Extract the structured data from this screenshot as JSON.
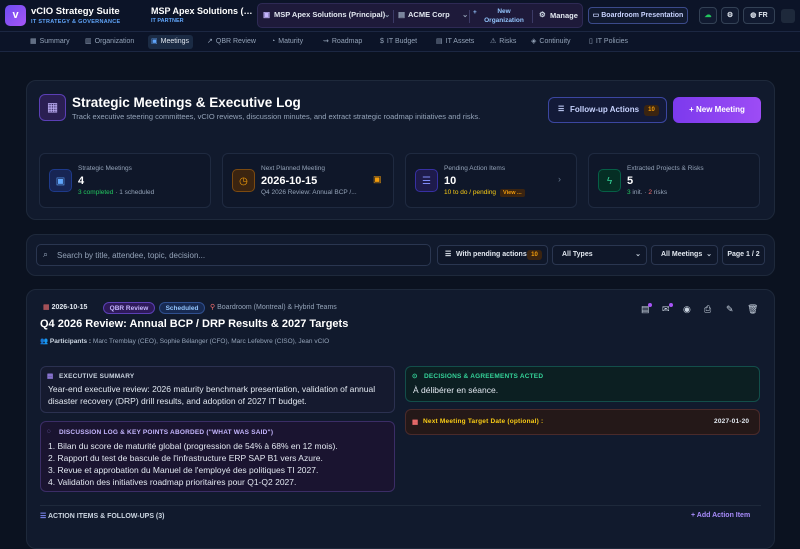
{
  "app": {
    "logo": "v",
    "title": "vCIO Strategy Suite",
    "subtitle": "IT STRATEGY & GOVERNANCE"
  },
  "tenant": {
    "title": "MSP Apex Solutions (Principal)",
    "subtitle": "IT PARTNER"
  },
  "context": {
    "msp": "MSP Apex Solutions (Principal)",
    "client": "ACME Corp",
    "new_org": "New Organization",
    "manage": "Manage"
  },
  "header_actions": {
    "presentation": "Boardroom Presentation",
    "language": "FR"
  },
  "nav": [
    {
      "label": "Summary",
      "icon": "summary-icon"
    },
    {
      "label": "Organization",
      "icon": "organization-icon"
    },
    {
      "label": "Meetings",
      "icon": "calendar-icon"
    },
    {
      "label": "QBR Review",
      "icon": "trend-icon"
    },
    {
      "label": "Maturity",
      "icon": "gauge-icon"
    },
    {
      "label": "Roadmap",
      "icon": "road-icon"
    },
    {
      "label": "IT Budget",
      "icon": "dollar-icon"
    },
    {
      "label": "IT Assets",
      "icon": "assets-icon"
    },
    {
      "label": "Risks",
      "icon": "warning-icon"
    },
    {
      "label": "Continuity",
      "icon": "shield-icon"
    },
    {
      "label": "IT Policies",
      "icon": "document-icon"
    }
  ],
  "page": {
    "title": "Strategic Meetings & Executive Log",
    "subtitle": "Track executive steering committees, vCIO reviews, discussion minutes, and extract strategic roadmap initiatives and risks.",
    "followup_label": "Follow-up Actions",
    "followup_count": "10",
    "new_meeting_label": "+ New Meeting"
  },
  "stats": [
    {
      "label": "Strategic Meetings",
      "value": "4",
      "sub_a": "3 completed",
      "sub_b": " · 1 scheduled"
    },
    {
      "label": "Next Planned Meeting",
      "value": "2026-10-15",
      "sub_a": "",
      "sub_b": "Q4 2026 Review: Annual BCP /..."
    },
    {
      "label": "Pending Action Items",
      "value": "10",
      "sub_a": "10 to do / pending",
      "sub_b": "View ..."
    },
    {
      "label": "Extracted Projects & Risks",
      "value": "5",
      "sub_a": "3",
      "sub_b": " init. · ",
      "sub_c": "2",
      "sub_d": " risks"
    }
  ],
  "filters": {
    "search_placeholder": "Search by title, attendee, topic, decision...",
    "pending_label": "With pending actions",
    "pending_count": "10",
    "type_select": "All Types",
    "meetings_select": "All Meetings",
    "page": "Page 1 / 2"
  },
  "meeting": {
    "date": "2026-10-15",
    "type": "QBR Review",
    "status": "Scheduled",
    "location": "Boardroom (Montreal) & Hybrid Teams",
    "title": "Q4 2026 Review: Annual BCP / DRP Results & 2027 Targets",
    "participants_label": "Participants :",
    "participants": "Marc Tremblay (CEO), Sophie Bélanger (CFO), Marc Lefebvre (CISO), Jean vCIO",
    "summary_heading": "EXECUTIVE SUMMARY",
    "summary_text": "Year-end executive review: 2026 maturity benchmark presentation, validation of annual disaster recovery (DRP) drill results, and adoption of 2027 IT budget.",
    "decisions_heading": "DECISIONS & AGREEMENTS ACTED",
    "decisions_text": "À délibérer en séance.",
    "discussion_heading": "DISCUSSION LOG & KEY POINTS ABORDED (\"WHAT WAS SAID\")",
    "discussion_items": [
      "1. Bilan du score de maturité global (progression de 54% à 68% en 12 mois).",
      "2. Rapport du test de bascule de l'infrastructure ERP SAP B1 vers Azure.",
      "3. Revue et approbation du Manuel de l'employé des politiques TI 2027.",
      "4. Validation des initiatives roadmap prioritaires pour Q1-Q2 2027."
    ],
    "next_label": "Next Meeting Target Date (optional) :",
    "next_date": "2027-01-20",
    "action_items_heading": "ACTION ITEMS & FOLLOW-UPS (3)",
    "add_action_label": "+ Add Action Item"
  },
  "colors": {
    "accent": "#7c3aed",
    "brand_blue": "#60a5fa",
    "success": "#22c55e",
    "warning": "#f59e0b",
    "danger": "#f87171"
  }
}
